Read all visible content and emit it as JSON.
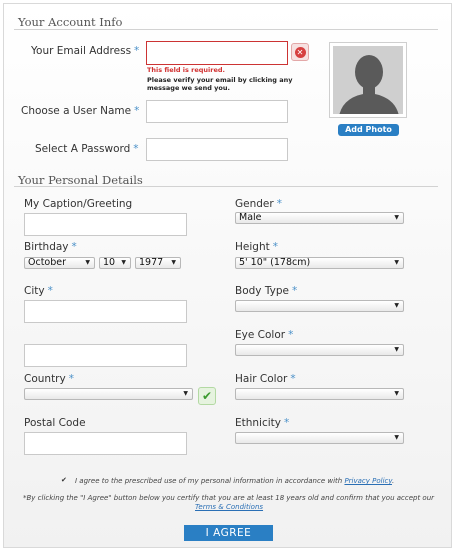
{
  "account": {
    "title": "Your Account Info",
    "email_label": "Your Email Address",
    "email_error": "This field is required.",
    "email_note": "Please verify your email by clicking any message we send you.",
    "username_label": "Choose a User Name",
    "password_label": "Select A Password",
    "required_mark": "*",
    "add_photo": "Add Photo"
  },
  "personal": {
    "title": "Your Personal Details",
    "caption_label": "My Caption/Greeting",
    "birthday_label": "Birthday",
    "birthday_month": "October",
    "birthday_day": "10",
    "birthday_year": "1977",
    "city_label": "City",
    "country_label": "Country",
    "postal_label": "Postal Code",
    "gender_label": "Gender",
    "gender_value": "Male",
    "height_label": "Height",
    "height_value": "5' 10\" (178cm)",
    "body_type_label": "Body Type",
    "eye_color_label": "Eye Color",
    "hair_color_label": "Hair Color",
    "ethnicity_label": "Ethnicity",
    "select_arrow": "▼",
    "check_mark": "✔"
  },
  "agreement": {
    "consent_text": "I agree to the prescribed use of my personal information in accordance with ",
    "privacy_link": "Privacy Policy",
    "period": ".",
    "terms_text": "*By clicking the \"I Agree\" button below you certify that you are at least 18 years old and confirm that you accept our",
    "terms_link": "Terms & Conditions",
    "agree_button": "I AGREE"
  },
  "colors": {
    "accent": "#2a7fc4",
    "error": "#cc3333",
    "success": "#3b9a2e",
    "required": "#4a90c8"
  }
}
